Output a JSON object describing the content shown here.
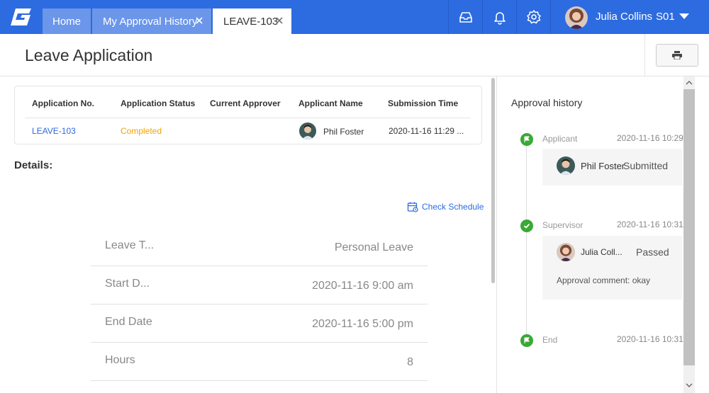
{
  "app": {
    "logo": "G",
    "accent": "#2d6be0"
  },
  "tabs": [
    {
      "label": "Home",
      "closable": false
    },
    {
      "label": "My Approval History",
      "closable": true
    },
    {
      "label": "LEAVE-103",
      "closable": true,
      "active": true
    }
  ],
  "topbar_icons": [
    "inbox-icon",
    "bell-icon",
    "gear-icon"
  ],
  "user": {
    "name": "Julia Collins",
    "code": "S01"
  },
  "page": {
    "title": "Leave Application"
  },
  "summary": {
    "headers": [
      "Application No.",
      "Application Status",
      "Current Approver",
      "Applicant Name",
      "Submission Time"
    ],
    "application_no": "LEAVE-103",
    "status": "Completed",
    "current_approver": "",
    "applicant_name": "Phil Foster",
    "submission_time": "2020-11-16 11:29 ..."
  },
  "details": {
    "title": "Details:",
    "check_schedule": "Check Schedule",
    "rows": [
      {
        "label": "Leave T...",
        "value": "Personal Leave"
      },
      {
        "label": "Start D...",
        "value": "2020-11-16 9:00 am"
      },
      {
        "label": "End Date",
        "value": "2020-11-16 5:00 pm"
      },
      {
        "label": "Hours",
        "value": "8"
      }
    ]
  },
  "history": {
    "title": "Approval history",
    "steps": [
      {
        "label": "Applicant",
        "time": "2020-11-16 10:29",
        "name": "Phil Foster",
        "action": "Submitted"
      },
      {
        "label": "Supervisor",
        "time": "2020-11-16 10:31",
        "name": "Julia Coll...",
        "action": "Passed",
        "comment": "Approval comment: okay"
      },
      {
        "label": "End",
        "time": "2020-11-16 10:31"
      }
    ]
  }
}
